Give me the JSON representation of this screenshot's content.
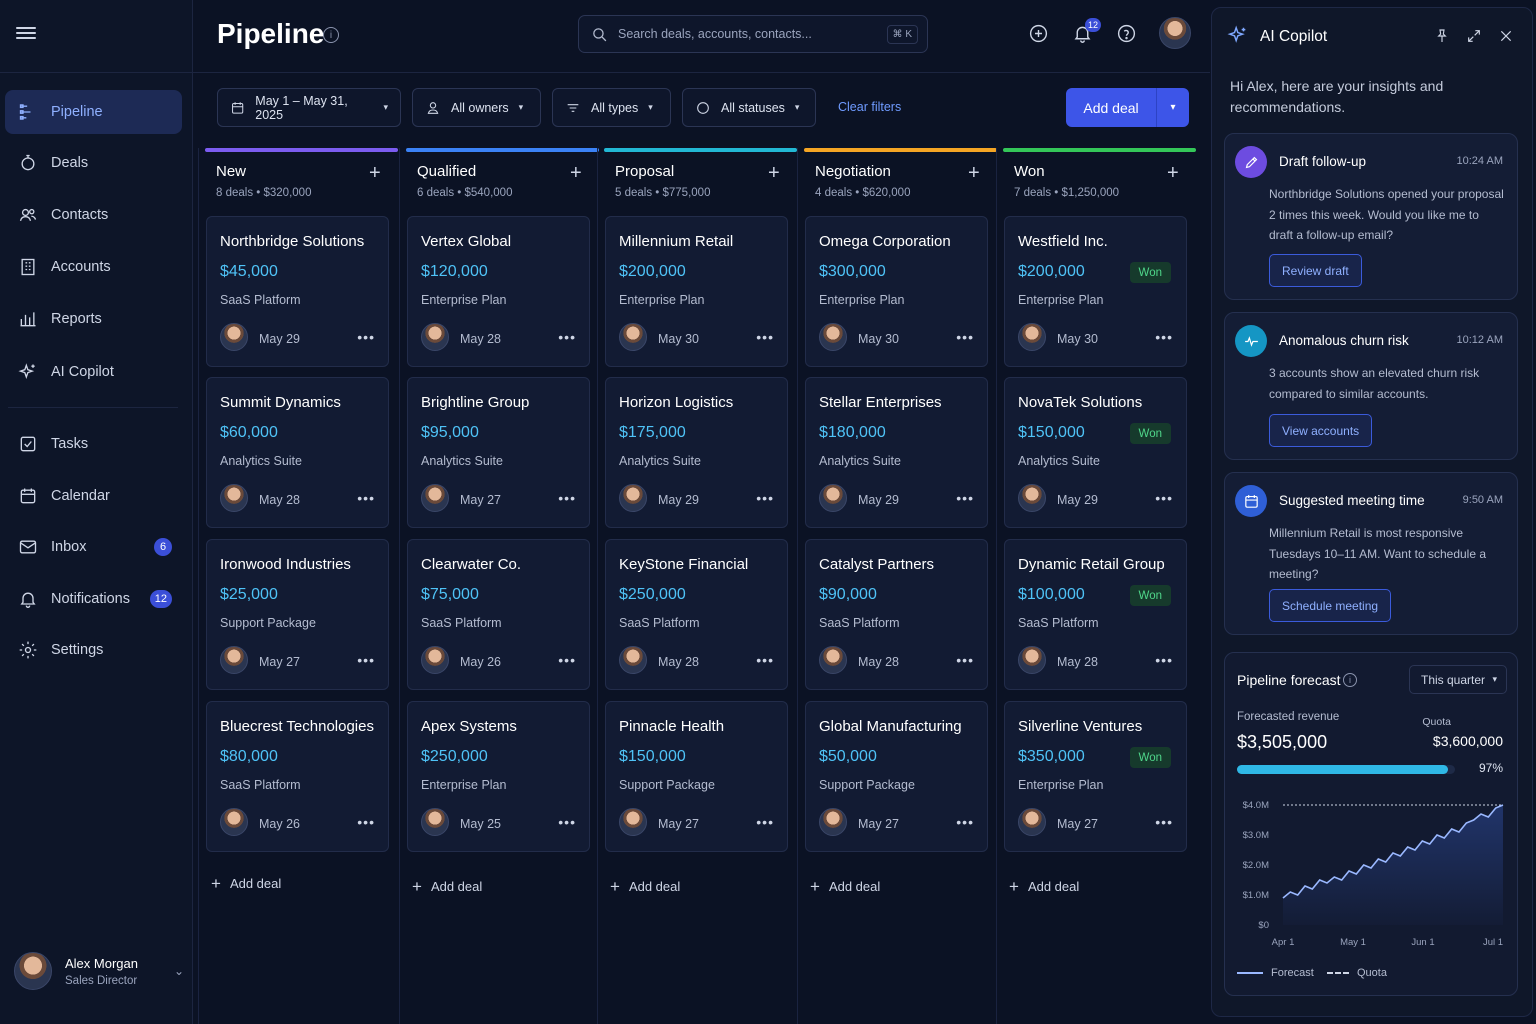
{
  "sidebar": {
    "nav": [
      {
        "label": "Pipeline",
        "icon": "pipeline-icon",
        "active": true
      },
      {
        "label": "Deals",
        "icon": "deals-icon"
      },
      {
        "label": "Contacts",
        "icon": "contacts-icon"
      },
      {
        "label": "Accounts",
        "icon": "accounts-icon"
      },
      {
        "label": "Reports",
        "icon": "reports-icon"
      },
      {
        "label": "AI Copilot",
        "icon": "sparkle-icon"
      },
      {
        "label": "Tasks",
        "icon": "tasks-icon"
      },
      {
        "label": "Calendar",
        "icon": "calendar-icon"
      },
      {
        "label": "Inbox",
        "icon": "inbox-icon",
        "badge": "6"
      },
      {
        "label": "Notifications",
        "icon": "bell-icon",
        "badge": "12"
      },
      {
        "label": "Settings",
        "icon": "settings-icon"
      }
    ],
    "user": {
      "name": "Alex Morgan",
      "role": "Sales Director"
    }
  },
  "header": {
    "title": "Pipeline",
    "search_placeholder": "Search deals, accounts, contacts...",
    "shortcut": "⌘ K",
    "notification_count": "12"
  },
  "filters": {
    "date": "May 1 – May 31, 2025",
    "owners": "All owners",
    "types": "All types",
    "statuses": "All statuses",
    "clear": "Clear filters",
    "add_deal": "Add deal"
  },
  "columns": [
    {
      "name": "New",
      "summary": "8 deals  •  $320,000",
      "color": "#7c5cf0",
      "add_label": "Add deal",
      "cards": [
        {
          "name": "Northbridge Solutions",
          "amount": "$45,000",
          "plan": "SaaS Platform",
          "date": "May 29"
        },
        {
          "name": "Summit Dynamics",
          "amount": "$60,000",
          "plan": "Analytics Suite",
          "date": "May 28"
        },
        {
          "name": "Ironwood Industries",
          "amount": "$25,000",
          "plan": "Support Package",
          "date": "May 27"
        },
        {
          "name": "Bluecrest Technologies",
          "amount": "$80,000",
          "plan": "SaaS Platform",
          "date": "May 26"
        }
      ]
    },
    {
      "name": "Qualified",
      "summary": "6 deals  •  $540,000",
      "color": "#3b82f6",
      "add_label": "Add deal",
      "cards": [
        {
          "name": "Vertex Global",
          "amount": "$120,000",
          "plan": "Enterprise Plan",
          "date": "May 28"
        },
        {
          "name": "Brightline Group",
          "amount": "$95,000",
          "plan": "Analytics Suite",
          "date": "May 27"
        },
        {
          "name": "Clearwater Co.",
          "amount": "$75,000",
          "plan": "SaaS Platform",
          "date": "May 26"
        },
        {
          "name": "Apex Systems",
          "amount": "$250,000",
          "plan": "Enterprise Plan",
          "date": "May 25"
        }
      ]
    },
    {
      "name": "Proposal",
      "summary": "5 deals  •  $775,000",
      "color": "#22b8d4",
      "add_label": "Add deal",
      "cards": [
        {
          "name": "Millennium Retail",
          "amount": "$200,000",
          "plan": "Enterprise Plan",
          "date": "May 30"
        },
        {
          "name": "Horizon Logistics",
          "amount": "$175,000",
          "plan": "Analytics Suite",
          "date": "May 29"
        },
        {
          "name": "KeyStone Financial",
          "amount": "$250,000",
          "plan": "SaaS Platform",
          "date": "May 28"
        },
        {
          "name": "Pinnacle Health",
          "amount": "$150,000",
          "plan": "Support Package",
          "date": "May 27"
        }
      ]
    },
    {
      "name": "Negotiation",
      "summary": "4 deals  •  $620,000",
      "color": "#f5a524",
      "add_label": "Add deal",
      "cards": [
        {
          "name": "Omega Corporation",
          "amount": "$300,000",
          "plan": "Enterprise Plan",
          "date": "May 30"
        },
        {
          "name": "Stellar Enterprises",
          "amount": "$180,000",
          "plan": "Analytics Suite",
          "date": "May 29"
        },
        {
          "name": "Catalyst Partners",
          "amount": "$90,000",
          "plan": "SaaS Platform",
          "date": "May 28"
        },
        {
          "name": "Global Manufacturing",
          "amount": "$50,000",
          "plan": "Support Package",
          "date": "May 27"
        }
      ]
    },
    {
      "name": "Won",
      "summary": "7 deals  •  $1,250,000",
      "color": "#34c759",
      "add_label": "Add deal",
      "cards": [
        {
          "name": "Westfield Inc.",
          "amount": "$200,000",
          "plan": "Enterprise Plan",
          "date": "May 30",
          "badge": "Won"
        },
        {
          "name": "NovaTek Solutions",
          "amount": "$150,000",
          "plan": "Analytics Suite",
          "date": "May 29",
          "badge": "Won"
        },
        {
          "name": "Dynamic Retail Group",
          "amount": "$100,000",
          "plan": "SaaS Platform",
          "date": "May 28",
          "badge": "Won"
        },
        {
          "name": "Silverline Ventures",
          "amount": "$350,000",
          "plan": "Enterprise Plan",
          "date": "May 27",
          "badge": "Won"
        }
      ]
    }
  ],
  "copilot": {
    "title": "AI Copilot",
    "intro": "Hi Alex, here are your insights and recommendations.",
    "insights": [
      {
        "title": "Draft follow-up",
        "time": "10:24 AM",
        "body": "Northbridge Solutions opened your proposal 2 times this week. Would you like me to draft a follow-up email?",
        "button": "Review draft",
        "icon": "pencil-icon",
        "color": "#6d4ce0"
      },
      {
        "title": "Anomalous churn risk",
        "time": "10:12 AM",
        "body": "3 accounts show an elevated churn risk compared to similar accounts.",
        "button": "View accounts",
        "icon": "pulse-icon",
        "color": "#1596c4"
      },
      {
        "title": "Suggested meeting time",
        "time": "9:50 AM",
        "body": "Millennium Retail is most responsive Tuesdays 10–11 AM. Want to schedule a meeting?",
        "button": "Schedule meeting",
        "icon": "calendar-icon",
        "color": "#2f5fd6"
      }
    ],
    "forecast": {
      "title": "Pipeline forecast",
      "period": "This quarter",
      "revenue_label": "Forecasted revenue",
      "revenue": "$3,505,000",
      "quota_label": "Quota",
      "quota": "$3,600,000",
      "progress": 0.97,
      "progress_label": "97%"
    }
  },
  "chart_data": {
    "type": "area",
    "yticks": [
      "$4.0M",
      "$3.0M",
      "$2.0M",
      "$1.0M",
      "$0"
    ],
    "xticks": [
      "Apr 1",
      "May 1",
      "Jun 1",
      "Jul 1"
    ],
    "ylim": [
      0,
      4.0
    ],
    "series": [
      {
        "name": "Forecast",
        "values": [
          0.9,
          1.1,
          1.0,
          1.3,
          1.2,
          1.5,
          1.4,
          1.6,
          1.5,
          1.8,
          1.7,
          2.0,
          1.9,
          2.2,
          2.1,
          2.4,
          2.3,
          2.6,
          2.5,
          2.8,
          2.7,
          3.0,
          2.9,
          3.2,
          3.1,
          3.4,
          3.5,
          3.7,
          3.6,
          3.9,
          4.0
        ]
      },
      {
        "name": "Quota",
        "values": [
          4.0,
          4.0
        ]
      }
    ],
    "legend": [
      "Forecast",
      "Quota"
    ]
  }
}
